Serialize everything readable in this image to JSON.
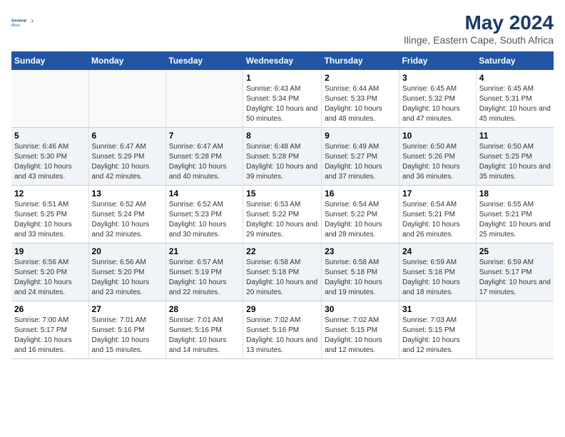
{
  "logo": {
    "line1": "General",
    "line2": "Blue"
  },
  "title": "May 2024",
  "subtitle": "Ilinge, Eastern Cape, South Africa",
  "days_of_week": [
    "Sunday",
    "Monday",
    "Tuesday",
    "Wednesday",
    "Thursday",
    "Friday",
    "Saturday"
  ],
  "weeks": [
    [
      {
        "num": "",
        "sunrise": "",
        "sunset": "",
        "daylight": ""
      },
      {
        "num": "",
        "sunrise": "",
        "sunset": "",
        "daylight": ""
      },
      {
        "num": "",
        "sunrise": "",
        "sunset": "",
        "daylight": ""
      },
      {
        "num": "1",
        "sunrise": "Sunrise: 6:43 AM",
        "sunset": "Sunset: 5:34 PM",
        "daylight": "Daylight: 10 hours and 50 minutes."
      },
      {
        "num": "2",
        "sunrise": "Sunrise: 6:44 AM",
        "sunset": "Sunset: 5:33 PM",
        "daylight": "Daylight: 10 hours and 48 minutes."
      },
      {
        "num": "3",
        "sunrise": "Sunrise: 6:45 AM",
        "sunset": "Sunset: 5:32 PM",
        "daylight": "Daylight: 10 hours and 47 minutes."
      },
      {
        "num": "4",
        "sunrise": "Sunrise: 6:45 AM",
        "sunset": "Sunset: 5:31 PM",
        "daylight": "Daylight: 10 hours and 45 minutes."
      }
    ],
    [
      {
        "num": "5",
        "sunrise": "Sunrise: 6:46 AM",
        "sunset": "Sunset: 5:30 PM",
        "daylight": "Daylight: 10 hours and 43 minutes."
      },
      {
        "num": "6",
        "sunrise": "Sunrise: 6:47 AM",
        "sunset": "Sunset: 5:29 PM",
        "daylight": "Daylight: 10 hours and 42 minutes."
      },
      {
        "num": "7",
        "sunrise": "Sunrise: 6:47 AM",
        "sunset": "Sunset: 5:28 PM",
        "daylight": "Daylight: 10 hours and 40 minutes."
      },
      {
        "num": "8",
        "sunrise": "Sunrise: 6:48 AM",
        "sunset": "Sunset: 5:28 PM",
        "daylight": "Daylight: 10 hours and 39 minutes."
      },
      {
        "num": "9",
        "sunrise": "Sunrise: 6:49 AM",
        "sunset": "Sunset: 5:27 PM",
        "daylight": "Daylight: 10 hours and 37 minutes."
      },
      {
        "num": "10",
        "sunrise": "Sunrise: 6:50 AM",
        "sunset": "Sunset: 5:26 PM",
        "daylight": "Daylight: 10 hours and 36 minutes."
      },
      {
        "num": "11",
        "sunrise": "Sunrise: 6:50 AM",
        "sunset": "Sunset: 5:25 PM",
        "daylight": "Daylight: 10 hours and 35 minutes."
      }
    ],
    [
      {
        "num": "12",
        "sunrise": "Sunrise: 6:51 AM",
        "sunset": "Sunset: 5:25 PM",
        "daylight": "Daylight: 10 hours and 33 minutes."
      },
      {
        "num": "13",
        "sunrise": "Sunrise: 6:52 AM",
        "sunset": "Sunset: 5:24 PM",
        "daylight": "Daylight: 10 hours and 32 minutes."
      },
      {
        "num": "14",
        "sunrise": "Sunrise: 6:52 AM",
        "sunset": "Sunset: 5:23 PM",
        "daylight": "Daylight: 10 hours and 30 minutes."
      },
      {
        "num": "15",
        "sunrise": "Sunrise: 6:53 AM",
        "sunset": "Sunset: 5:22 PM",
        "daylight": "Daylight: 10 hours and 29 minutes."
      },
      {
        "num": "16",
        "sunrise": "Sunrise: 6:54 AM",
        "sunset": "Sunset: 5:22 PM",
        "daylight": "Daylight: 10 hours and 28 minutes."
      },
      {
        "num": "17",
        "sunrise": "Sunrise: 6:54 AM",
        "sunset": "Sunset: 5:21 PM",
        "daylight": "Daylight: 10 hours and 26 minutes."
      },
      {
        "num": "18",
        "sunrise": "Sunrise: 6:55 AM",
        "sunset": "Sunset: 5:21 PM",
        "daylight": "Daylight: 10 hours and 25 minutes."
      }
    ],
    [
      {
        "num": "19",
        "sunrise": "Sunrise: 6:56 AM",
        "sunset": "Sunset: 5:20 PM",
        "daylight": "Daylight: 10 hours and 24 minutes."
      },
      {
        "num": "20",
        "sunrise": "Sunrise: 6:56 AM",
        "sunset": "Sunset: 5:20 PM",
        "daylight": "Daylight: 10 hours and 23 minutes."
      },
      {
        "num": "21",
        "sunrise": "Sunrise: 6:57 AM",
        "sunset": "Sunset: 5:19 PM",
        "daylight": "Daylight: 10 hours and 22 minutes."
      },
      {
        "num": "22",
        "sunrise": "Sunrise: 6:58 AM",
        "sunset": "Sunset: 5:18 PM",
        "daylight": "Daylight: 10 hours and 20 minutes."
      },
      {
        "num": "23",
        "sunrise": "Sunrise: 6:58 AM",
        "sunset": "Sunset: 5:18 PM",
        "daylight": "Daylight: 10 hours and 19 minutes."
      },
      {
        "num": "24",
        "sunrise": "Sunrise: 6:59 AM",
        "sunset": "Sunset: 5:18 PM",
        "daylight": "Daylight: 10 hours and 18 minutes."
      },
      {
        "num": "25",
        "sunrise": "Sunrise: 6:59 AM",
        "sunset": "Sunset: 5:17 PM",
        "daylight": "Daylight: 10 hours and 17 minutes."
      }
    ],
    [
      {
        "num": "26",
        "sunrise": "Sunrise: 7:00 AM",
        "sunset": "Sunset: 5:17 PM",
        "daylight": "Daylight: 10 hours and 16 minutes."
      },
      {
        "num": "27",
        "sunrise": "Sunrise: 7:01 AM",
        "sunset": "Sunset: 5:16 PM",
        "daylight": "Daylight: 10 hours and 15 minutes."
      },
      {
        "num": "28",
        "sunrise": "Sunrise: 7:01 AM",
        "sunset": "Sunset: 5:16 PM",
        "daylight": "Daylight: 10 hours and 14 minutes."
      },
      {
        "num": "29",
        "sunrise": "Sunrise: 7:02 AM",
        "sunset": "Sunset: 5:16 PM",
        "daylight": "Daylight: 10 hours and 13 minutes."
      },
      {
        "num": "30",
        "sunrise": "Sunrise: 7:02 AM",
        "sunset": "Sunset: 5:15 PM",
        "daylight": "Daylight: 10 hours and 12 minutes."
      },
      {
        "num": "31",
        "sunrise": "Sunrise: 7:03 AM",
        "sunset": "Sunset: 5:15 PM",
        "daylight": "Daylight: 10 hours and 12 minutes."
      },
      {
        "num": "",
        "sunrise": "",
        "sunset": "",
        "daylight": ""
      }
    ]
  ]
}
